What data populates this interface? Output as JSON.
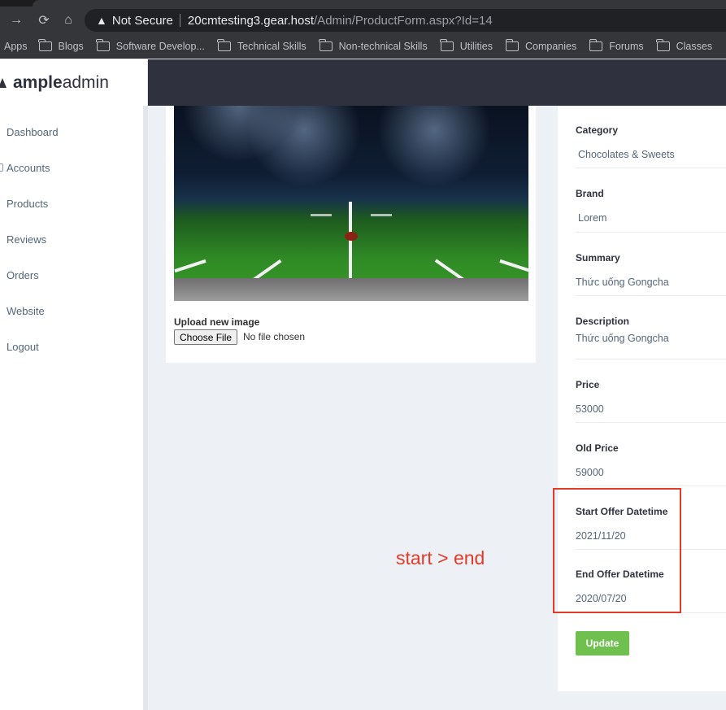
{
  "browser": {
    "security_label": "Not Secure",
    "url_host": "20cmtesting3.gear.host",
    "url_path": "/Admin/ProductForm.aspx?Id=14",
    "bookmarks": [
      "Apps",
      "Blogs",
      "Software Develop...",
      "Technical Skills",
      "Non-technical Skills",
      "Utilities",
      "Companies",
      "Forums",
      "Classes"
    ]
  },
  "logo": {
    "bold": "ample",
    "light": "admin"
  },
  "sidebar": {
    "items": [
      {
        "label": "Dashboard"
      },
      {
        "label": "Accounts"
      },
      {
        "label": "Products"
      },
      {
        "label": "Reviews"
      },
      {
        "label": "Orders"
      },
      {
        "label": "Website"
      },
      {
        "label": "Logout"
      }
    ]
  },
  "image_panel": {
    "upload_label": "Upload new image",
    "choose_button": "Choose File",
    "file_status": "No file chosen"
  },
  "form": {
    "fields": [
      {
        "label": "Category",
        "value": "Chocolates & Sweets"
      },
      {
        "label": "Brand",
        "value": "Lorem"
      },
      {
        "label": "Summary",
        "value": "Thức uống Gongcha"
      },
      {
        "label": "Description",
        "value": "Thức uống Gongcha"
      },
      {
        "label": "Price",
        "value": "53000"
      },
      {
        "label": "Old Price",
        "value": "59000"
      },
      {
        "label": "Start Offer Datetime",
        "value": "2021/11/20"
      },
      {
        "label": "End Offer Datetime",
        "value": "2020/07/20"
      }
    ],
    "update_button": "Update"
  },
  "annotation": {
    "text": "start > end",
    "color": "#e13b2a"
  }
}
